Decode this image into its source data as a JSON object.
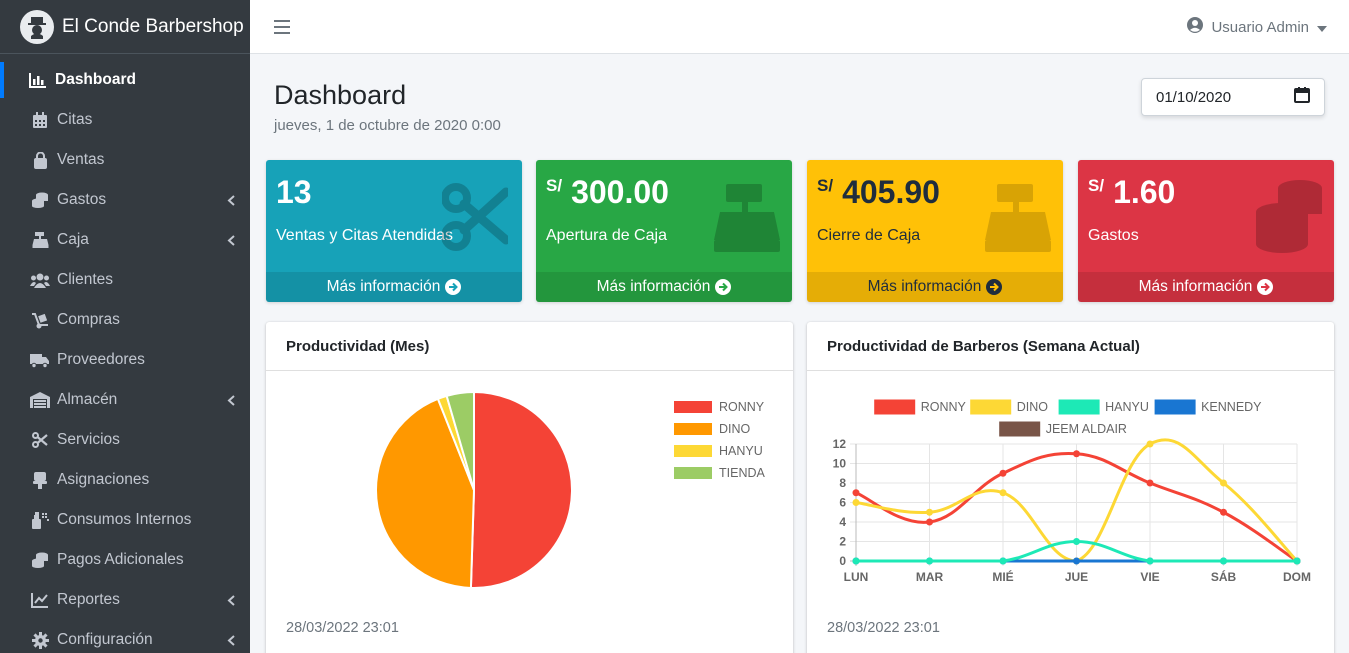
{
  "brand": {
    "name": "El Conde Barbershop"
  },
  "sidebar": {
    "items": [
      {
        "label": "Dashboard",
        "icon": "chart-area-icon",
        "caret": false,
        "active": true
      },
      {
        "label": "Citas",
        "icon": "calendar-icon",
        "caret": false
      },
      {
        "label": "Ventas",
        "icon": "shopping-bag-icon",
        "caret": false
      },
      {
        "label": "Gastos",
        "icon": "coins-icon",
        "caret": true
      },
      {
        "label": "Caja",
        "icon": "cash-register-icon",
        "caret": true
      },
      {
        "label": "Clientes",
        "icon": "users-icon",
        "caret": false
      },
      {
        "label": "Compras",
        "icon": "dolly-icon",
        "caret": false
      },
      {
        "label": "Proveedores",
        "icon": "truck-icon",
        "caret": false
      },
      {
        "label": "Almacén",
        "icon": "warehouse-icon",
        "caret": true
      },
      {
        "label": "Servicios",
        "icon": "scissors-icon",
        "caret": false
      },
      {
        "label": "Asignaciones",
        "icon": "chair-icon",
        "caret": false
      },
      {
        "label": "Consumos Internos",
        "icon": "spray-icon",
        "caret": false
      },
      {
        "label": "Pagos Adicionales",
        "icon": "coins-icon",
        "caret": false
      },
      {
        "label": "Reportes",
        "icon": "chart-line-icon",
        "caret": true
      },
      {
        "label": "Configuración",
        "icon": "gear-icon",
        "caret": true
      }
    ]
  },
  "header": {
    "user": "Usuario Admin"
  },
  "page": {
    "title": "Dashboard",
    "subtitle": "jueves, 1 de octubre de 2020 0:00",
    "date_value": "01/10/2020"
  },
  "boxes": [
    {
      "value": "13",
      "currency": "",
      "label": "Ventas y Citas Atendidas",
      "footer": "Más información",
      "color": "#17a2b8",
      "icon": "scissors-icon"
    },
    {
      "value": "300.00",
      "currency": "S/",
      "label": "Apertura de Caja",
      "footer": "Más información",
      "color": "#28a745",
      "icon": "cash-register-icon"
    },
    {
      "value": "405.90",
      "currency": "S/",
      "label": "Cierre de Caja",
      "footer": "Más información",
      "color": "#ffc107",
      "icon": "cash-register-icon"
    },
    {
      "value": "1.60",
      "currency": "S/",
      "label": "Gastos",
      "footer": "Más información",
      "color": "#dc3545",
      "icon": "coins-icon"
    }
  ],
  "cards": {
    "pie": {
      "title": "Productividad (Mes)",
      "footer": "28/03/2022 23:01"
    },
    "line": {
      "title": "Productividad de Barberos (Semana Actual)",
      "footer": "28/03/2022 23:01"
    }
  },
  "chart_data": [
    {
      "type": "pie",
      "title": "Productividad (Mes)",
      "labels": [
        "RONNY",
        "DINO",
        "HANYU",
        "TIENDA"
      ],
      "values": [
        50.5,
        43.5,
        1.5,
        4.5
      ],
      "colors": [
        "#f44336",
        "#ff9800",
        "#fdd835",
        "#9ccc65"
      ],
      "legend": "right"
    },
    {
      "type": "line",
      "title": "Productividad de Barberos (Semana Actual)",
      "categories": [
        "LUN",
        "MAR",
        "MIÉ",
        "JUE",
        "VIE",
        "SÁB",
        "DOM"
      ],
      "ylim": [
        0,
        12
      ],
      "yticks": [
        0,
        2,
        4,
        6,
        8,
        10,
        12
      ],
      "grid": true,
      "legend": "top",
      "series": [
        {
          "name": "RONNY",
          "color": "#f44336",
          "values": [
            7,
            4,
            9,
            11,
            8,
            5,
            0
          ]
        },
        {
          "name": "DINO",
          "color": "#fdd835",
          "values": [
            6,
            5,
            7,
            0,
            12,
            8,
            0
          ]
        },
        {
          "name": "HANYU",
          "color": "#1de9b6",
          "values": [
            0,
            0,
            0,
            2,
            0,
            0,
            0
          ]
        },
        {
          "name": "KENNEDY",
          "color": "#1976d2",
          "values": [
            0,
            0,
            0,
            0,
            0,
            0,
            0
          ]
        },
        {
          "name": "JEEM ALDAIR",
          "color": "#795548",
          "values": [
            0,
            0,
            0,
            0,
            0,
            0,
            0
          ]
        }
      ]
    }
  ]
}
